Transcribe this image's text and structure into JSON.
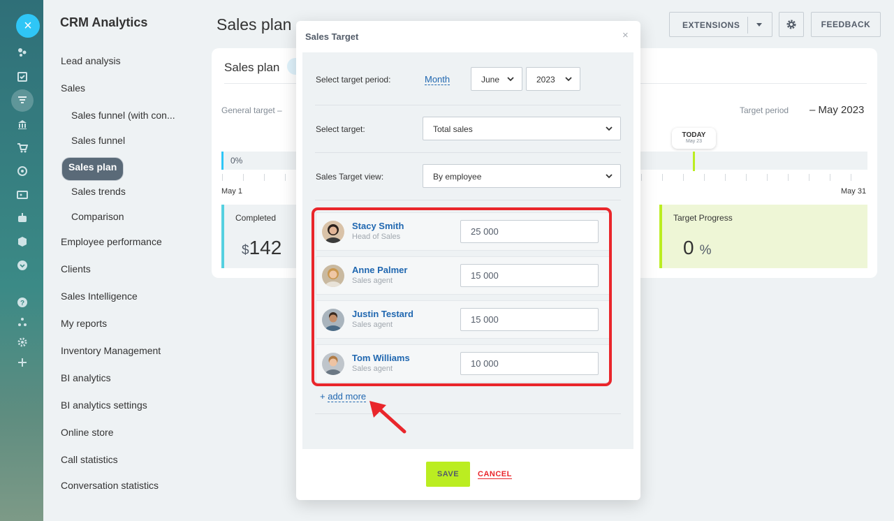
{
  "app": {
    "title": "CRM Analytics",
    "page_title": "Sales plan"
  },
  "sidebar": {
    "items": [
      {
        "label": "Lead analysis"
      },
      {
        "label": "Sales"
      },
      {
        "label": "Sales funnel (with con..."
      },
      {
        "label": "Sales funnel"
      },
      {
        "label": "Sales plan"
      },
      {
        "label": "Sales trends"
      },
      {
        "label": "Comparison"
      },
      {
        "label": "Employee performance"
      },
      {
        "label": "Clients"
      },
      {
        "label": "Sales Intelligence"
      },
      {
        "label": "My reports"
      },
      {
        "label": "Inventory Management"
      },
      {
        "label": "BI analytics"
      },
      {
        "label": "BI analytics settings"
      },
      {
        "label": "Online store"
      },
      {
        "label": "Call statistics"
      },
      {
        "label": "Conversation statistics"
      }
    ]
  },
  "toolbar": {
    "extensions_label": "EXTENSIONS",
    "feedback_label": "FEEDBACK"
  },
  "card": {
    "title": "Sales plan",
    "general_target_label": "General target  –",
    "target_period_label": "Target period",
    "target_period_value": "– May 2023",
    "today_label": "TODAY",
    "today_date": "May 23",
    "progress_pct": "0%",
    "date_start": "May 1",
    "date_end": "May 31",
    "completed_label": "Completed",
    "completed_currency": "$",
    "completed_value": "142",
    "target_progress_label": "Target Progress",
    "target_progress_value": "0",
    "target_progress_unit": "%"
  },
  "modal": {
    "title": "Sales Target",
    "close_glyph": "×",
    "period_label": "Select target period:",
    "period_type": "Month",
    "month": "June",
    "year": "2023",
    "target_label": "Select target:",
    "target_value": "Total sales",
    "view_label": "Sales Target view:",
    "view_value": "By employee",
    "employees": [
      {
        "name": "Stacy Smith",
        "role": "Head of Sales",
        "amount": "25 000"
      },
      {
        "name": "Anne Palmer",
        "role": "Sales agent",
        "amount": "15 000"
      },
      {
        "name": "Justin Testard",
        "role": "Sales agent",
        "amount": "15 000"
      },
      {
        "name": "Tom Williams",
        "role": "Sales agent",
        "amount": "10 000"
      }
    ],
    "add_more_prefix": "+",
    "add_more_label": "add more",
    "save_label": "SAVE",
    "cancel_label": "CANCEL"
  },
  "colors": {
    "accent": "#2fc6f6",
    "link": "#2067b0",
    "save": "#bbed21",
    "highlight": "#e9262b"
  }
}
